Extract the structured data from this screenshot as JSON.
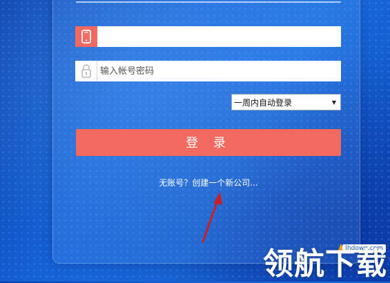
{
  "form": {
    "phone_value": "",
    "password_placeholder": "输入帐号密码",
    "remember_option": "一周内自动登录",
    "login_label": "登 录",
    "create_link": "无账号？创建一个新公司..."
  },
  "watermark": {
    "text": "领航下载",
    "url": "lhdown.com"
  },
  "colors": {
    "accent": "#f26a5f",
    "background": "#1561d6",
    "arrow": "#c8202a"
  },
  "icons": {
    "phone": "phone-icon",
    "lock": "lock-icon",
    "dropdown": "chevron-down-icon"
  }
}
